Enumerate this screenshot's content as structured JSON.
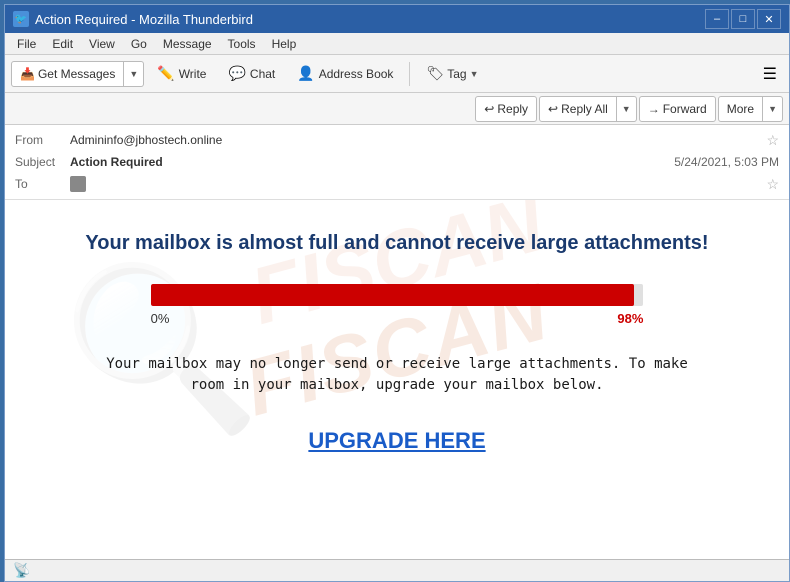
{
  "window": {
    "title": "Action Required - Mozilla Thunderbird",
    "icon": "🐦"
  },
  "title_controls": {
    "minimize": "–",
    "maximize": "□",
    "close": "✕"
  },
  "menu": {
    "items": [
      "File",
      "Edit",
      "View",
      "Go",
      "Message",
      "Tools",
      "Help"
    ]
  },
  "toolbar": {
    "get_messages": "Get Messages",
    "write": "Write",
    "chat": "Chat",
    "address_book": "Address Book",
    "tag": "Tag",
    "hamburger": "☰"
  },
  "reply_toolbar": {
    "reply": "Reply",
    "reply_all": "Reply All",
    "forward": "Forward",
    "more": "More"
  },
  "email_header": {
    "from_label": "From",
    "from_value": "Admininfo@jbhostech.online",
    "subject_label": "Subject",
    "subject_value": "Action Required",
    "to_label": "To",
    "to_value": "",
    "date": "5/24/2021, 5:03 PM"
  },
  "email_body": {
    "headline": "Your mailbox is almost full and cannot receive large attachments!",
    "progress_start": "0%",
    "progress_end": "98%",
    "progress_value": 98,
    "body_text": "Your mailbox may no longer send or receive large attachments. To make room in your mailbox, upgrade your mailbox below.",
    "upgrade_text": "UPGRADE HERE",
    "watermark": "FISCAN"
  },
  "status_bar": {
    "icon": "📡"
  }
}
